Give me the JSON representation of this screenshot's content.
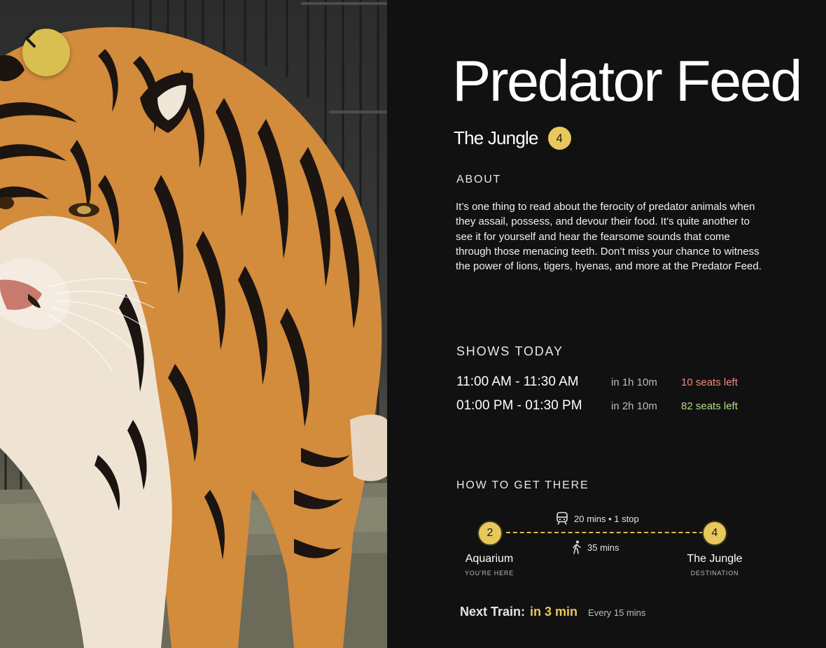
{
  "colors": {
    "accent": "#e8c85a",
    "background": "#111111",
    "seats_low": "#f08a7e",
    "seats_ok": "#b6dc86"
  },
  "back_button": {
    "icon": "chevron-left-icon"
  },
  "hero_image": {
    "subject": "tiger-photo"
  },
  "event": {
    "title": "Predator Feed",
    "location": "The Jungle",
    "zone_number": "4"
  },
  "about": {
    "heading": "ABOUT",
    "text": "It’s one thing to read about the ferocity of predator animals when they assail, possess, and devour their food. It’s quite another to see it for yourself and hear the fearsome sounds that come through those menacing teeth. Don’t miss your chance to witness the power of lions, tigers, hyenas, and more at the Predator Feed."
  },
  "shows": {
    "heading": "SHOWS TODAY",
    "items": [
      {
        "time": "11:00 AM - 11:30 AM",
        "starts_in": "in 1h 10m",
        "seats": "10 seats left",
        "status": "low"
      },
      {
        "time": "01:00 PM - 01:30 PM",
        "starts_in": "in 2h 10m",
        "seats": "82 seats left",
        "status": "ok"
      }
    ]
  },
  "directions": {
    "heading": "HOW TO GET THERE",
    "origin": {
      "number": "2",
      "name": "Aquarium",
      "sub": "YOU'RE HERE"
    },
    "destination": {
      "number": "4",
      "name": "The Jungle",
      "sub": "DESTINATION"
    },
    "train": {
      "icon": "train-icon",
      "text": "20 mins • 1 stop"
    },
    "walk": {
      "icon": "walking-icon",
      "text": "35 mins"
    },
    "next_train": {
      "label": "Next Train:",
      "value": "in 3 min",
      "frequency": "Every 15 mins"
    }
  }
}
